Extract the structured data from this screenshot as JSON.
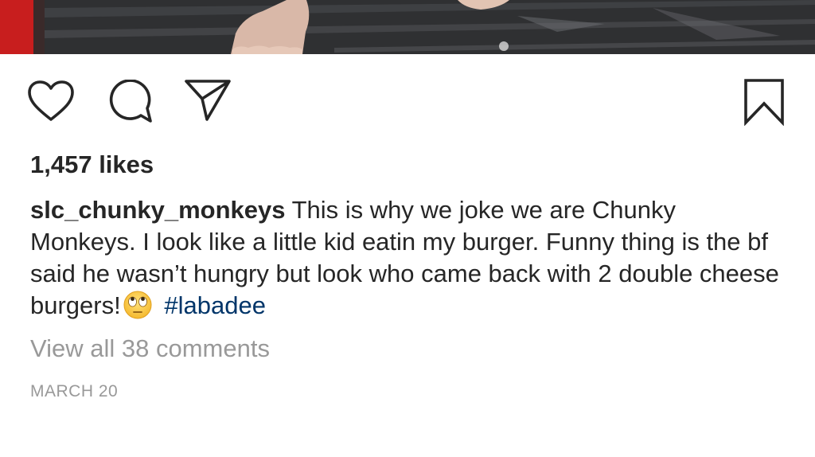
{
  "post": {
    "likes_text": "1,457 likes",
    "username": "slc_chunky_monkeys",
    "caption_text": "This is why we joke we are Chunky Monkeys. I look like a little kid eatin my burger. Funny thing is the bf said he wasn’t hungry but look who came back with 2 double cheese burgers!",
    "caption_emoji": "face-with-rolling-eyes",
    "hashtag": "#labadee",
    "view_comments_text": "View all 38 comments",
    "date_text": "MARCH 20"
  },
  "actions": {
    "icons": [
      "heart-icon",
      "comment-icon",
      "share-icon",
      "bookmark-icon"
    ]
  },
  "colors": {
    "text": "#262626",
    "hashtag": "#003569",
    "muted": "#999999",
    "background": "#ffffff"
  }
}
